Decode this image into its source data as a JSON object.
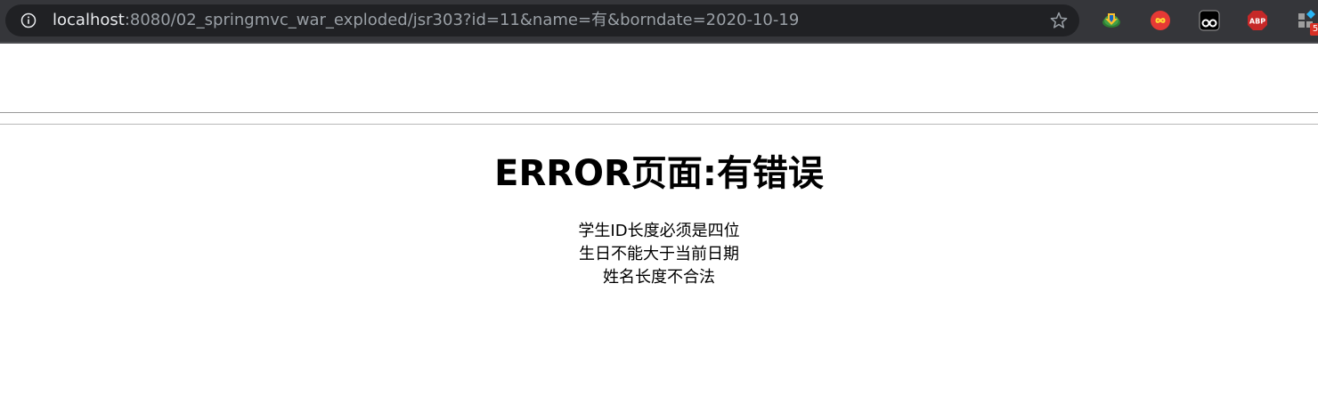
{
  "browser": {
    "url_host": "localhost",
    "url_rest": ":8080/02_springmvc_war_exploded/jsr303?id=11&name=有&borndate=2020-10-19",
    "icons": [
      "info-icon",
      "star-icon",
      "internet-download-manager-icon",
      "infinity-icon",
      "tampermonkey-icon",
      "adblock-plus-icon",
      "extension-grid-icon"
    ],
    "adblock_label": "ABP",
    "extension_badge": "5",
    "colors": {
      "toolbar": "#35363a",
      "omnibox": "#202124",
      "url_text": "#9aa0a6",
      "host_text": "#e8eaed"
    }
  },
  "page": {
    "title": "ERROR页面:有错误",
    "errors": [
      "学生ID长度必须是四位",
      "生日不能大于当前日期",
      "姓名长度不合法"
    ]
  }
}
